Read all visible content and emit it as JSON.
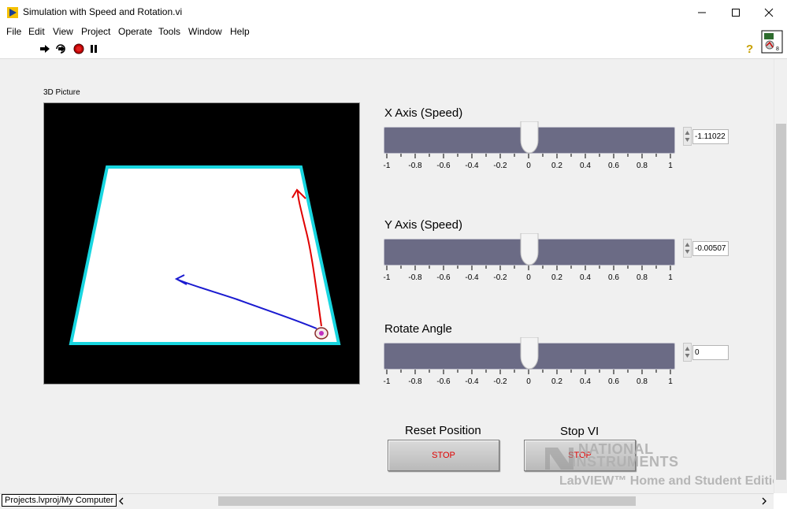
{
  "window": {
    "title": "Simulation with Speed and Rotation.vi",
    "minimize_icon": "minimize-icon",
    "maximize_icon": "maximize-icon",
    "close_icon": "close-icon"
  },
  "menu": [
    "File",
    "Edit",
    "View",
    "Project",
    "Operate",
    "Tools",
    "Window",
    "Help"
  ],
  "toolbar": {
    "icons": [
      "run-arrow-icon",
      "run-continuously-icon",
      "abort-icon",
      "pause-icon"
    ],
    "help_icon": "help-question-icon"
  },
  "picture": {
    "label": "3D Picture"
  },
  "sliders": [
    {
      "label": "X Axis (Speed)",
      "value_text": "-1.11022",
      "fraction": 0.5
    },
    {
      "label": "Y Axis (Speed)",
      "value_text": "-0.00507",
      "fraction": 0.5
    },
    {
      "label": "Rotate Angle",
      "value_text": "0",
      "fraction": 0.5
    }
  ],
  "ticks": [
    "-1",
    "-0.8",
    "-0.6",
    "-0.4",
    "-0.2",
    "0",
    "0.2",
    "0.4",
    "0.6",
    "0.8",
    "1"
  ],
  "buttons": {
    "reset_label": "Reset Position",
    "reset_text": "STOP",
    "stop_label": "Stop VI",
    "stop_text": "STOP"
  },
  "watermark": {
    "line1": "NATIONAL",
    "line2": "INSTRUMENTS",
    "line3": "LabVIEW™ Home and Student Edition"
  },
  "status": {
    "context": "Projects.lvproj/My Computer"
  },
  "colors": {
    "slider_track": "#6b6b85",
    "floor_border": "#18d6e0",
    "path_red": "#e00000",
    "path_blue": "#1a1ad0"
  }
}
